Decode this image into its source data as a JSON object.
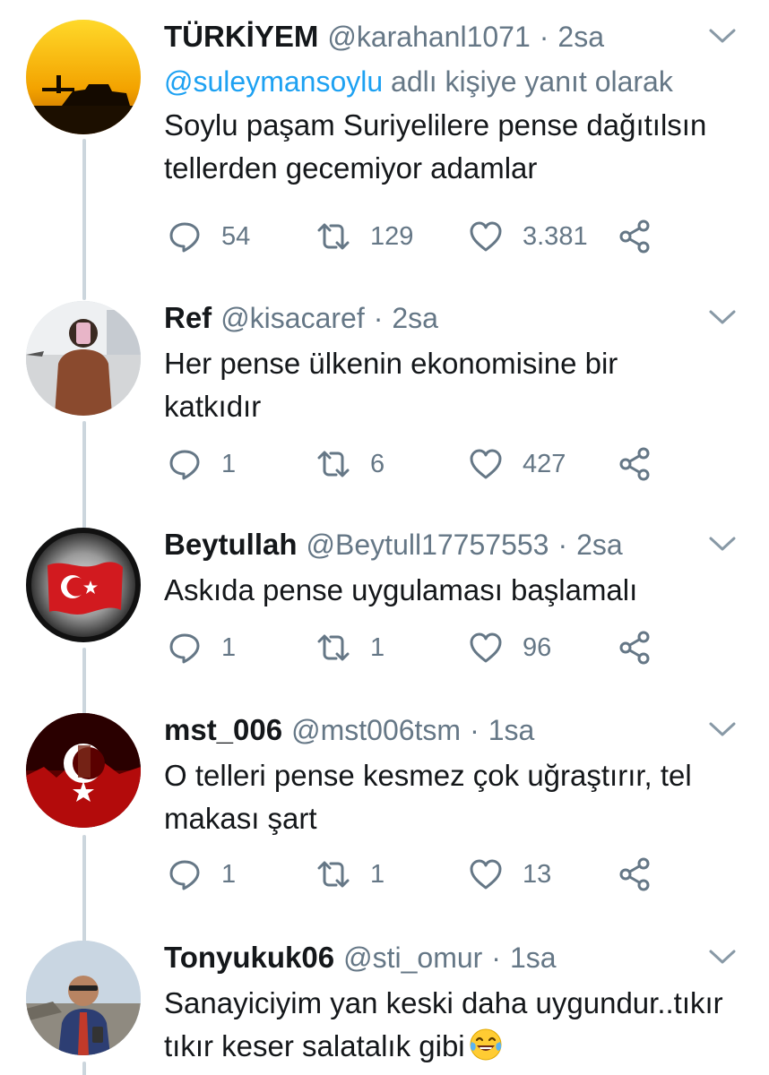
{
  "tweets": [
    {
      "display_name": "TÜRKİYEM",
      "handle": "@karahanl1071",
      "separator": "·",
      "time": "2sa",
      "reply_to": {
        "mention": "@suleymansoylu",
        "suffix": " adlı kişiye yanıt olarak"
      },
      "text": "Soylu paşam Suriyelilere pense dağıtılsın tellerden gecemiyor adamlar",
      "replies": "54",
      "retweets": "129",
      "likes": "3.381",
      "avatar": "sunset-tank-silhouette"
    },
    {
      "display_name": "Ref",
      "handle": "@kisacaref",
      "separator": "·",
      "time": "2sa",
      "text": "Her pense ülkenin ekonomisine bir katkıdır",
      "replies": "1",
      "retweets": "6",
      "likes": "427",
      "avatar": "child-in-brown-coat"
    },
    {
      "display_name": "Beytullah",
      "handle": "@Beytull17757553",
      "separator": "·",
      "time": "2sa",
      "text": "Askıda pense uygulaması başlamalı",
      "replies": "1",
      "retweets": "1",
      "likes": "96",
      "avatar": "turkish-flag-moon"
    },
    {
      "display_name": "mst_006",
      "handle": "@mst006tsm",
      "separator": "·",
      "time": "1sa",
      "text": "O telleri pense kesmez çok uğraştırır, tel makası şart",
      "replies": "1",
      "retweets": "1",
      "likes": "13",
      "avatar": "red-crescent-star"
    },
    {
      "display_name": "Tonyukuk06",
      "handle": "@sti_omur",
      "separator": "·",
      "time": "1sa",
      "text": "Sanayiciyim yan keski daha uygundur..tıkır tıkır keser salatalık gibi",
      "emoji": "tears-of-joy",
      "avatar": "man-with-phone"
    }
  ],
  "colors": {
    "secondary_text": "#657786",
    "link": "#1da1f2",
    "thread_line": "#ccd6dd",
    "primary_text": "#14171a"
  },
  "icons": [
    "reply-icon",
    "retweet-icon",
    "like-icon",
    "share-icon",
    "chevron-down-icon"
  ]
}
